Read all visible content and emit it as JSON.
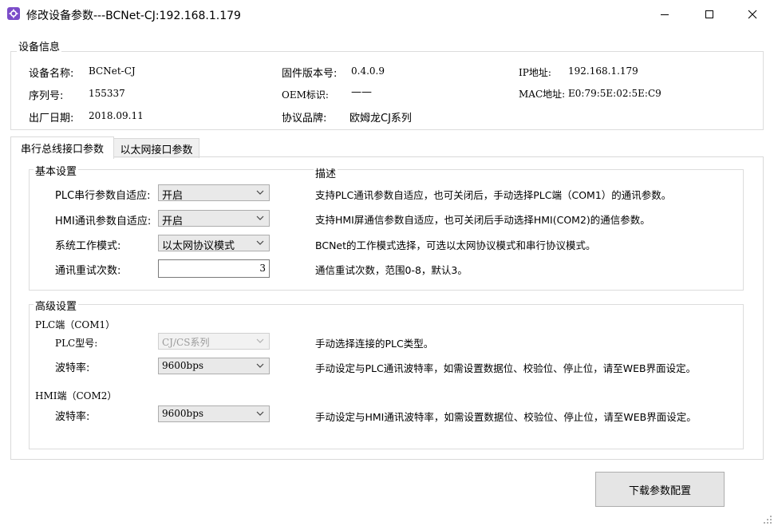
{
  "window": {
    "title": "修改设备参数---BCNet-CJ:192.168.1.179",
    "controls": [
      "minimize",
      "maximize",
      "close"
    ]
  },
  "device_info": {
    "legend": "设备信息",
    "device_name_label": "设备名称:",
    "device_name": "BCNet-CJ",
    "serial_label": "序列号:",
    "serial": "155337",
    "date_label": "出厂日期:",
    "date": "2018.09.11",
    "firmware_label": "固件版本号:",
    "firmware": "0.4.0.9",
    "oem_label": "OEM标识:",
    "oem": "——",
    "protocol_label": "协议品牌:",
    "protocol": "欧姆龙CJ系列",
    "ip_label": "IP地址:",
    "ip": "192.168.1.179",
    "mac_label": "MAC地址:",
    "mac": "E0:79:5E:02:5E:C9"
  },
  "tabs": [
    "串行总线接口参数",
    "以太网接口参数"
  ],
  "basic": {
    "legend": "基本设置",
    "desc_title": "描述",
    "plc_auto_label": "PLC串行参数自适应:",
    "plc_auto_value": "开启",
    "plc_auto_desc": "支持PLC通讯参数自适应，也可关闭后，手动选择PLC端（COM1）的通讯参数。",
    "hmi_auto_label": "HMI通讯参数自适应:",
    "hmi_auto_value": "开启",
    "hmi_auto_desc": "支持HMI屏通信参数自适应，也可关闭后手动选择HMI(COM2)的通信参数。",
    "mode_label": "系统工作模式:",
    "mode_value": "以太网协议模式",
    "mode_desc": "BCNet的工作模式选择，可选以太网协议模式和串行协议模式。",
    "retry_label": "通讯重试次数:",
    "retry_value": "3",
    "retry_desc": "通信重试次数，范围0-8，默认3。"
  },
  "advanced": {
    "legend": "高级设置",
    "plc_section": "PLC端（COM1）",
    "plc_model_label": "PLC型号:",
    "plc_model_value": "CJ/CS系列",
    "plc_model_desc": "手动选择连接的PLC类型。",
    "plc_baud_label": "波特率:",
    "plc_baud_value": "9600bps",
    "plc_baud_desc": "手动设定与PLC通讯波特率，如需设置数据位、校验位、停止位，请至WEB界面设定。",
    "hmi_section": "HMI端（COM2）",
    "hmi_baud_label": "波特率:",
    "hmi_baud_value": "9600bps",
    "hmi_baud_desc": "手动设定与HMI通讯波特率，如需设置数据位、校验位、停止位，请至WEB界面设定。"
  },
  "download_button": "下载参数配置",
  "colors": {
    "accent": "#7b4cc9",
    "border": "#dcdcdc",
    "button_bg": "#e5e5e5"
  }
}
